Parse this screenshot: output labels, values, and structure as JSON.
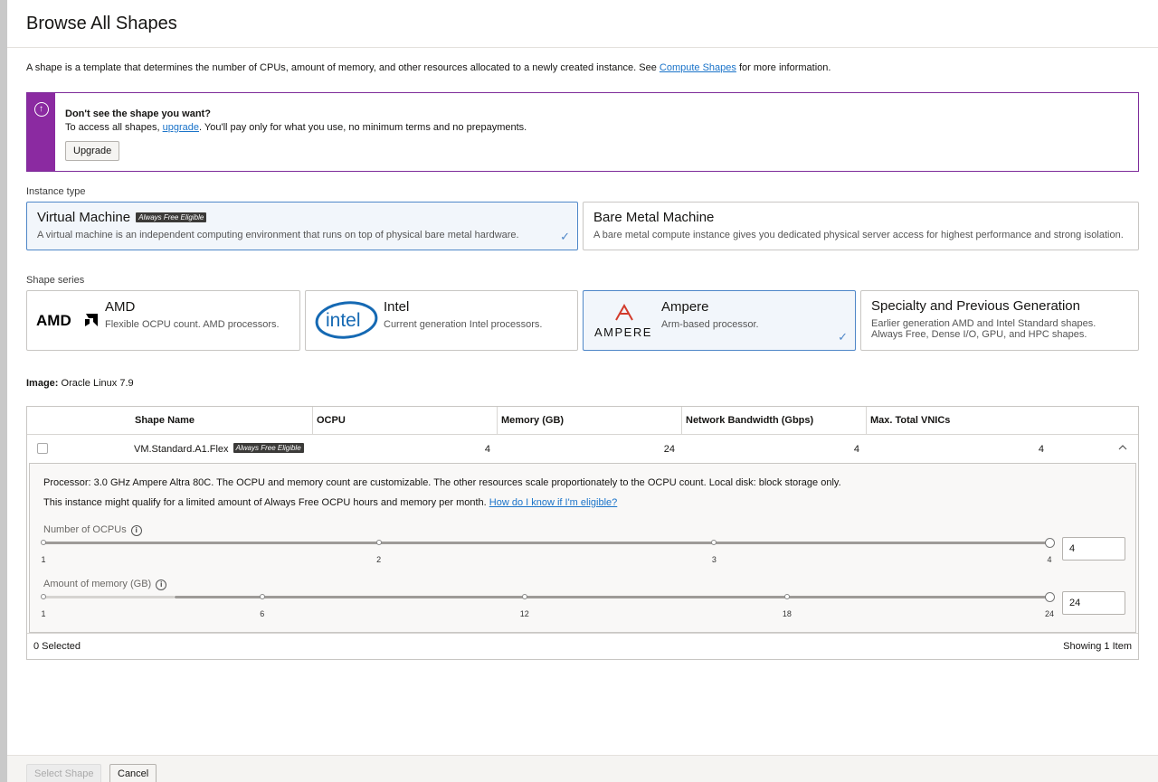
{
  "title": "Browse All Shapes",
  "intro": {
    "text": "A shape is a template that determines the number of CPUs, amount of memory, and other resources allocated to a newly created instance. See ",
    "link": "Compute Shapes",
    "suffix": " for more information."
  },
  "banner": {
    "title": "Don't see the shape you want?",
    "text_before": "To access all shapes, ",
    "link": "upgrade",
    "text_after": ". You'll pay only for what you use, no minimum terms and no prepayments.",
    "button": "Upgrade",
    "accent": "#8b2aa1"
  },
  "instance_type": {
    "label": "Instance type",
    "options": [
      {
        "title": "Virtual Machine",
        "badge": "Always Free Eligible",
        "desc": "A virtual machine is an independent computing environment that runs on top of physical bare metal hardware.",
        "selected": true
      },
      {
        "title": "Bare Metal Machine",
        "desc": "A bare metal compute instance gives you dedicated physical server access for highest performance and strong isolation.",
        "selected": false
      }
    ]
  },
  "shape_series": {
    "label": "Shape series",
    "options": [
      {
        "title": "AMD",
        "desc": "Flexible OCPU count. AMD processors.",
        "logo": "AMDA",
        "selected": false
      },
      {
        "title": "Intel",
        "desc": "Current generation Intel processors.",
        "logo": "intel",
        "selected": false
      },
      {
        "title": "Ampere",
        "desc": "Arm-based processor.",
        "logo": "AMPERE",
        "selected": true
      },
      {
        "title": "Specialty and Previous Generation",
        "desc": "Earlier generation AMD and Intel Standard shapes. Always Free, Dense I/O, GPU, and HPC shapes.",
        "selected": false
      }
    ]
  },
  "image": {
    "label": "Image:",
    "value": "Oracle Linux 7.9"
  },
  "table": {
    "columns": [
      "Shape Name",
      "OCPU",
      "Memory (GB)",
      "Network Bandwidth (Gbps)",
      "Max. Total VNICs"
    ],
    "row": {
      "name": "VM.Standard.A1.Flex",
      "badge": "Always Free Eligible",
      "ocpu": "4",
      "memory": "24",
      "bandwidth": "4",
      "vnics": "4"
    },
    "details": {
      "processor": "Processor: 3.0 GHz Ampere Altra 80C. The OCPU and memory count are customizable. The other resources scale proportionately to the OCPU count. Local disk: block storage only.",
      "free_text": "This instance might qualify for a limited amount of Always Free OCPU hours and memory per month. ",
      "free_link": "How do I know if I'm eligible?",
      "ocpu_slider": {
        "label": "Number of OCPUs",
        "ticks": [
          "1",
          "2",
          "3",
          "4"
        ],
        "value": "4",
        "fraction": 1.0
      },
      "memory_slider": {
        "label": "Amount of memory (GB)",
        "ticks": [
          "1",
          "6",
          "12",
          "18",
          "24"
        ],
        "value": "24",
        "fraction": 1.0
      }
    },
    "footer": {
      "selected": "0 Selected",
      "showing": "Showing 1 Item"
    }
  },
  "actions": {
    "select": "Select Shape",
    "cancel": "Cancel"
  }
}
